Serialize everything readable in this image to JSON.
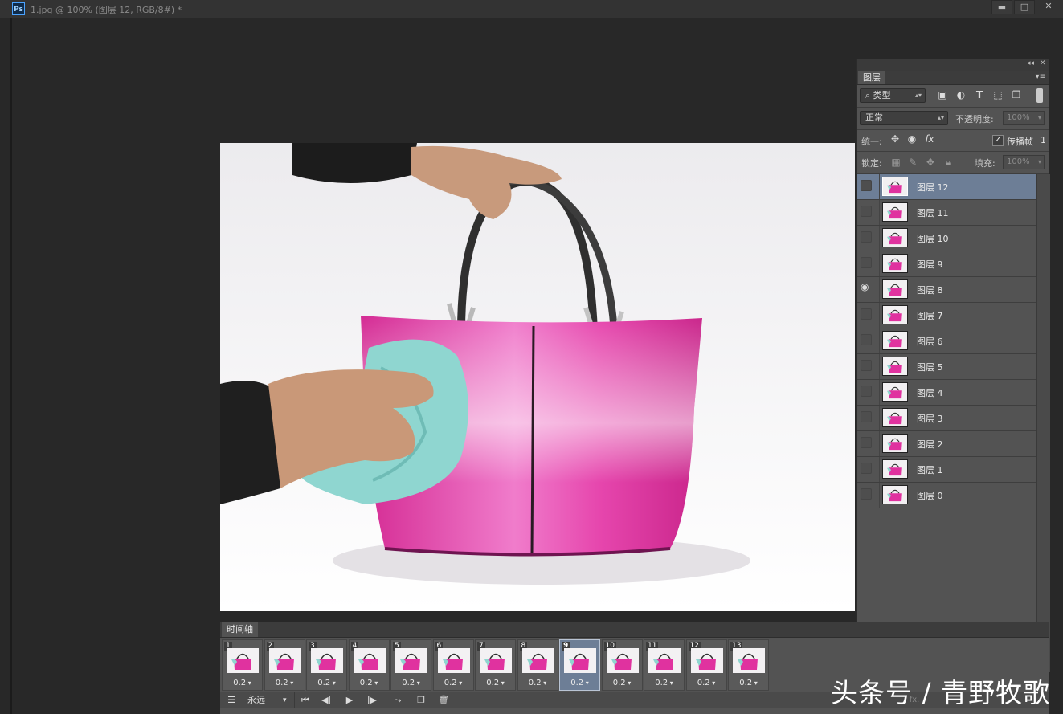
{
  "window": {
    "app_icon_text": "Ps",
    "title": "1.jpg @ 100% (图层 12, RGB/8#) *",
    "minimize_glyph": "▬",
    "maximize_glyph": "□",
    "close_glyph": "✕"
  },
  "layers_panel": {
    "collapse_glyph": "◂◂",
    "close_glyph": "✕",
    "tab_label": "图层",
    "menu_glyph": "▾≡",
    "filter_kind": "类型",
    "filter_icons": [
      "image-filter-icon",
      "adjustment-filter-icon",
      "type-filter-icon",
      "shape-filter-icon",
      "smart-object-filter-icon"
    ],
    "blend_mode": "正常",
    "opacity_label": "不透明度:",
    "opacity_value": "100%",
    "unify_label": "统一:",
    "propagate_label": "传播帧",
    "propagate_value": "1",
    "propagate_checked": true,
    "lock_label": "锁定:",
    "fill_label": "填充:",
    "fill_value": "100%",
    "layers": [
      {
        "name": "图层 12",
        "visible": false,
        "selected": true
      },
      {
        "name": "图层 11",
        "visible": false,
        "selected": false
      },
      {
        "name": "图层 10",
        "visible": false,
        "selected": false
      },
      {
        "name": "图层 9",
        "visible": false,
        "selected": false
      },
      {
        "name": "图层 8",
        "visible": true,
        "selected": false
      },
      {
        "name": "图层 7",
        "visible": false,
        "selected": false
      },
      {
        "name": "图层 6",
        "visible": false,
        "selected": false
      },
      {
        "name": "图层 5",
        "visible": false,
        "selected": false
      },
      {
        "name": "图层 4",
        "visible": false,
        "selected": false
      },
      {
        "name": "图层 3",
        "visible": false,
        "selected": false
      },
      {
        "name": "图层 2",
        "visible": false,
        "selected": false
      },
      {
        "name": "图层 1",
        "visible": false,
        "selected": false
      },
      {
        "name": "图层 0",
        "visible": false,
        "selected": false
      }
    ]
  },
  "timeline": {
    "tab_label": "时间轴",
    "frames": [
      {
        "number": "1",
        "delay": "0.2"
      },
      {
        "number": "2",
        "delay": "0.2"
      },
      {
        "number": "3",
        "delay": "0.2"
      },
      {
        "number": "4",
        "delay": "0.2"
      },
      {
        "number": "5",
        "delay": "0.2"
      },
      {
        "number": "6",
        "delay": "0.2"
      },
      {
        "number": "7",
        "delay": "0.2"
      },
      {
        "number": "8",
        "delay": "0.2"
      },
      {
        "number": "9",
        "delay": "0.2",
        "selected": true
      },
      {
        "number": "10",
        "delay": "0.2"
      },
      {
        "number": "11",
        "delay": "0.2"
      },
      {
        "number": "12",
        "delay": "0.2"
      },
      {
        "number": "13",
        "delay": "0.2"
      }
    ],
    "loop_option": "永远",
    "fx_label": "fx."
  },
  "watermark": "头条号 / 青野牧歌",
  "colors": {
    "bag_pink": "#e0329f",
    "cloth_cyan": "#8fd6d0",
    "selection_blue": "#6d7e96"
  }
}
